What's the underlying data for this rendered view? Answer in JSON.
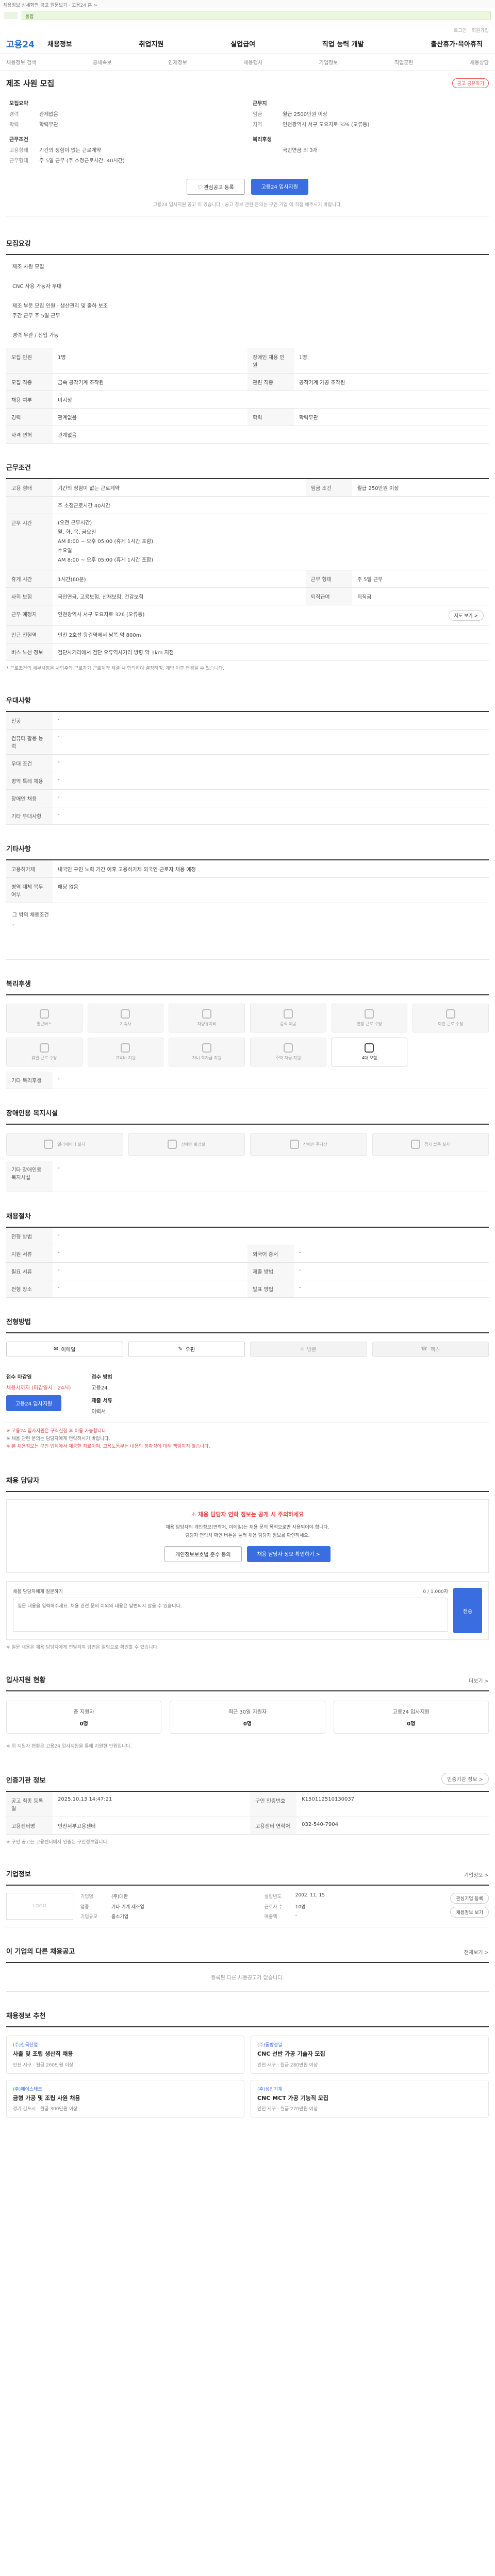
{
  "top_notice": "채용정보 상세화면 공고 원문보기 · 고용24 홈 >",
  "search": {
    "tag": "통합"
  },
  "util_links": [
    "로그인",
    "회원가입"
  ],
  "gnb": {
    "brand": "고용24",
    "menu": [
      "채용정보",
      "취업지원",
      "실업급여",
      "직업 능력 개발",
      "출산휴가·육아휴직"
    ]
  },
  "subnav": [
    "채용정보 검색",
    "공채속보",
    "인재정보",
    "채용행사",
    "기업정보",
    "직업훈련",
    "채용상담"
  ],
  "job": {
    "title": "제조 사원 모집",
    "share": "공고 공유하기",
    "left_block": {
      "h1": "모집요약",
      "rows": [
        {
          "k": "경력",
          "v": "관계없음"
        },
        {
          "k": "학력",
          "v": "학력무관"
        }
      ],
      "h2": "근무조건",
      "rows2": [
        {
          "k": "고용형태",
          "v": "기간의 정함이 없는 근로계약"
        },
        {
          "k": "근무형태",
          "v": "주 5일 근무 (주 소정근로시간: 40시간)"
        }
      ]
    },
    "right_block": {
      "h1": "근무지",
      "rows": [
        {
          "k": "임금",
          "v": "월급 2500만원 이상"
        },
        {
          "k": "지역",
          "v": "인천광역시 서구 도요지로 326 (오류동)"
        }
      ],
      "h2": "복리후생",
      "rows2": [
        {
          "k": "",
          "v": "국민연금 외 3개"
        }
      ]
    },
    "btn_interest": "관심공고 등록",
    "btn_apply": "고용24 입사지원",
    "note": "고용24 입사지원 공고 이 있습니다 · 공고 정보 관련 문의는 구인 기업 에 직접 해주시기 바랍니다."
  },
  "recruit": {
    "title": "모집요강",
    "desc": "제조 사원 모집\n\nCNC 사용 가능자 우대\n\n제조 부문 모집 인원 · 생산관리 및 출하 보조\n주간 근무 주 5일 근무\n\n경력 무관 / 신입 가능",
    "rows": [
      {
        "k1": "모집 인원",
        "v1": "1명",
        "k2": "장애인 채용 인원",
        "v2": "1명"
      },
      {
        "k1": "모집 직종",
        "v1": "금속 공작기계 조작원",
        "k2": "관련 직종",
        "v2": "공작기계 가공 조작원"
      },
      {
        "k1": "채용 여부",
        "v1": "미지정",
        "k2": "",
        "v2": ""
      },
      {
        "k1": "경력",
        "v1": "관계없음",
        "k2": "학력",
        "v2": "학력무관"
      },
      {
        "k1": "자격 면허",
        "v1": "관계없음",
        "k2": "",
        "v2": ""
      }
    ]
  },
  "work": {
    "title": "근무조건",
    "rows": [
      {
        "k": "고용 형태",
        "v": "기간의 정함이 없는 근로계약",
        "k2": "임금 조건",
        "v2": "월급 250만원 이상"
      },
      {
        "k": "",
        "v": "주 소정근로시간 40시간",
        "k2": "",
        "v2": ""
      },
      {
        "k": "근무 시간",
        "v": "(오전 근무시간)\n월, 화, 목, 금요일\nAM 8:00 ~ 오후 05:00 (휴게 1시간 포함)\n수요일\nAM 8:00 ~ 오후 05:00 (휴게 1시간 포함)",
        "k2": "",
        "v2": ""
      },
      {
        "k": "휴게 시간",
        "v": "1시간(60분)",
        "k2": "근무 형태",
        "v2": "주 5일 근무"
      },
      {
        "k": "사회 보험",
        "v": "국민연금, 고용보험, 산재보험, 건강보험",
        "k2": "퇴직급여",
        "v2": "퇴직금"
      },
      {
        "k": "근무 예정지",
        "v": "인천광역시 서구 도요지로 326 (오류동)",
        "k2": "",
        "v2": ""
      },
      {
        "k": "인근 전철역",
        "v": "인천 2호선 왕길역에서 남쪽 약 800m",
        "k2": "",
        "v2": ""
      },
      {
        "k": "버스 노선 정보",
        "v": "검단사거리에서 검단 오류역사거리 방향 약 1km 지점",
        "k2": "",
        "v2": ""
      }
    ],
    "map_btn": "지도 보기 >",
    "note": "* 근로조건의 세부사항은 사업주와 근로자가 근로계약 체결 시 합의하여 결정하며, 계약 이후 변경될 수 있습니다."
  },
  "preference": {
    "title": "우대사항",
    "rows": [
      {
        "k": "전공",
        "v": "-"
      },
      {
        "k": "컴퓨터 활용 능력",
        "v": "-"
      },
      {
        "k": "우대 조건",
        "v": "-"
      },
      {
        "k": "병역 특례 채용",
        "v": "-"
      },
      {
        "k": "장애인 채용",
        "v": "-"
      },
      {
        "k": "기타 우대사항",
        "v": "-"
      }
    ]
  },
  "extra": {
    "title": "기타사항",
    "rows": [
      {
        "k": "고용허가제",
        "v": "내국인 구인 노력 기간 이후 고용허가제 외국인 근로자 채용 예정"
      },
      {
        "k": "병역 대체 복무 여부",
        "v": "해당 없음"
      }
    ],
    "desc": "그 밖의 채용조건\n-"
  },
  "welfare": {
    "title": "복리후생",
    "tiles": [
      {
        "label": "통근버스",
        "on": false
      },
      {
        "label": "기숙사",
        "on": false
      },
      {
        "label": "차량유지비",
        "on": false
      },
      {
        "label": "중식 제공",
        "on": false
      },
      {
        "label": "연장 근로 수당",
        "on": false
      },
      {
        "label": "야간 근로 수당",
        "on": false
      },
      {
        "label": "휴일 근로 수당",
        "on": false
      },
      {
        "label": "교육비 지원",
        "on": false
      },
      {
        "label": "자녀 학자금 지원",
        "on": false
      },
      {
        "label": "주택 자금 지원",
        "on": false
      },
      {
        "label": "4대 보험",
        "on": true
      }
    ],
    "extra_label": "기타 복리후생",
    "extra_value": "-"
  },
  "disabled_support": {
    "title": "장애인용 복지시설",
    "tiles": [
      {
        "label": "엘리베이터 설치",
        "on": false
      },
      {
        "label": "장애인 화장실",
        "on": false
      },
      {
        "label": "장애인 주차장",
        "on": false
      },
      {
        "label": "점자 블록 설치",
        "on": false
      }
    ],
    "extra_label": "기타 장애인용 복지시설",
    "extra_value": "-"
  },
  "process": {
    "title": "채용절차",
    "rows": [
      {
        "k": "전형 방법",
        "v": "-",
        "k2": "",
        "v2": ""
      },
      {
        "k": "지원 서류",
        "v": "-",
        "k2": "외국어 증서",
        "v2": "-"
      },
      {
        "k": "필요 서류",
        "v": "-",
        "k2": "제출 방법",
        "v2": "-"
      },
      {
        "k": "전형 장소",
        "v": "-",
        "k2": "발표 방법",
        "v2": "-"
      }
    ]
  },
  "apply": {
    "title": "전형방법",
    "methods": [
      {
        "label": "이메일",
        "on": true
      },
      {
        "label": "우편",
        "on": true
      },
      {
        "label": "방문",
        "on": false
      },
      {
        "label": "팩스",
        "on": false
      }
    ],
    "deadline_k": "접수 마감일",
    "deadline_v": "채용시까지 (마감일시 : 24시)",
    "method_k": "접수 방법",
    "method_v": "고용24",
    "method_btn": "고용24 입사지원",
    "doc_k": "제출 서류",
    "doc_v": "이력서",
    "warnings": [
      "※ 고용24 입사지원은 구직신청 후 이용 가능합니다.",
      "※ 채용 관련 문의는 담당자에게 연락하시기 바랍니다.",
      "※ 본 채용정보는 구인 업체에서 제공한 자료이며, 고용노동부는 내용의 정확성에 대해 책임지지 않습니다."
    ]
  },
  "contact": {
    "title": "채용 담당자",
    "alert_title": "채용 담당자 연락 정보는 공개 시 주의하세요",
    "alert_text": "채용 담당자의 개인정보(연락처, 이메일)는 채용 문의 목적으로만 사용되어야 합니다.\n담당자 연락처 확인 버튼을 눌러 채용 담당자 정보를 확인하세요.",
    "btn1": "개인정보보호법 준수 동의",
    "btn2": "채용 담당자 정보 확인하기 >",
    "inquiry_label": "채용 담당자에게 질문하기",
    "inquiry_count": "0 / 1,000자",
    "inquiry_placeholder": "질문 내용을 입력해주세요. 채용 관련 문의 이외의 내용은 답변되지 않을 수 있습니다.",
    "inquiry_send": "전송",
    "inquiry_note": "※ 질문 내용은 채용 담당자에게 전달되며 답변은 알림으로 확인할 수 있습니다."
  },
  "status": {
    "title": "입사지원 현황",
    "aux": "더보기 >",
    "items": [
      {
        "k": "총 지원자",
        "v": "0명"
      },
      {
        "k": "최근 30일 지원자",
        "v": "0명"
      },
      {
        "k": "고용24 입사지원",
        "v": "0명"
      }
    ],
    "note": "※ 위 지원자 현황은 고용24 입사지원을 통해 지원한 인원입니다."
  },
  "info": {
    "title": "인증기관 정보",
    "aux": "인증기관 정보 >",
    "rows": [
      {
        "k": "공고 최종 등록일",
        "v": "2025.10.13 14:47:21",
        "k2": "구인 인증번호",
        "v2": "K150112510130037"
      },
      {
        "k": "고용센터명",
        "v": "인천서부고용센터",
        "k2": "고용센터 연락처",
        "v2": "032-540-7904"
      }
    ],
    "note": "※ 구인 공고는 고용센터에서 인증된 구인정보입니다."
  },
  "company": {
    "title": "기업정보",
    "aux": "기업정보 >",
    "logo_text": "LOGO",
    "rows": [
      {
        "k": "기업명",
        "v": "(주)대한",
        "k2": "설립년도",
        "v2": "2002. 11. 15"
      },
      {
        "k": "업종",
        "v": "기타 기계 제조업",
        "k2": "근로자 수",
        "v2": "10명"
      },
      {
        "k": "기업규모",
        "v": "중소기업",
        "k2": "매출액",
        "v2": "-"
      }
    ],
    "btn1": "관심기업 등록",
    "btn2": "채용정보 보기"
  },
  "others": {
    "title": "이 기업의 다른 채용공고",
    "aux": "전체보기 >",
    "empty": "등록된 다른 채용공고가 없습니다."
  },
  "recommend": {
    "title": "채용정보 추천",
    "items": [
      {
        "co": "(주)한국산업",
        "title": "사출 및 조립 생산직 채용",
        "meta": "인천 서구 · 월급 260만원 이상"
      },
      {
        "co": "(주)동방정밀",
        "title": "CNC 선반 가공 기술자 모집",
        "meta": "인천 서구 · 월급 280만원 이상"
      },
      {
        "co": "(주)에이스테크",
        "title": "금형 가공 및 조립 사원 채용",
        "meta": "경기 김포시 · 월급 300만원 이상"
      },
      {
        "co": "(주)성진기계",
        "title": "CNC MCT 가공 기능직 모집",
        "meta": "인천 서구 · 월급 270만원 이상"
      }
    ]
  }
}
